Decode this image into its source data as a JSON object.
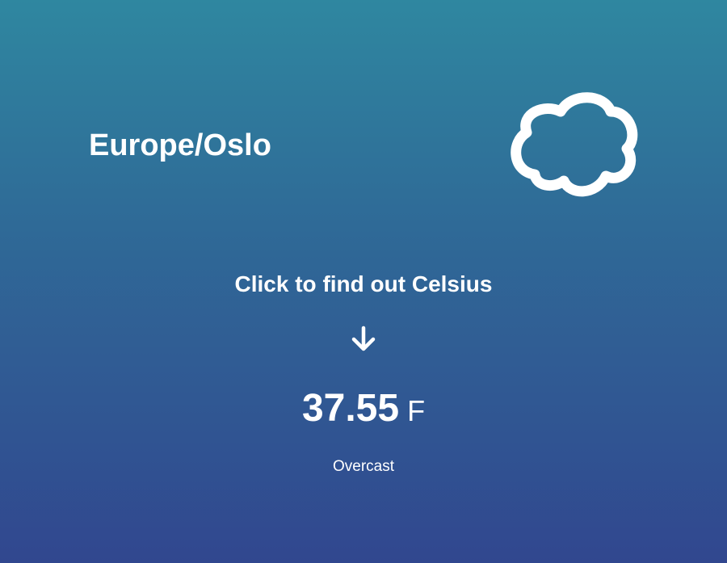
{
  "location": {
    "timezone": "Europe/Oslo"
  },
  "weather": {
    "icon": "cloudy-icon",
    "prompt": "Click to find out Celsius",
    "arrow_icon": "arrow-down-icon",
    "temperature_value": "37.55",
    "temperature_unit": "F",
    "description": "Overcast"
  }
}
